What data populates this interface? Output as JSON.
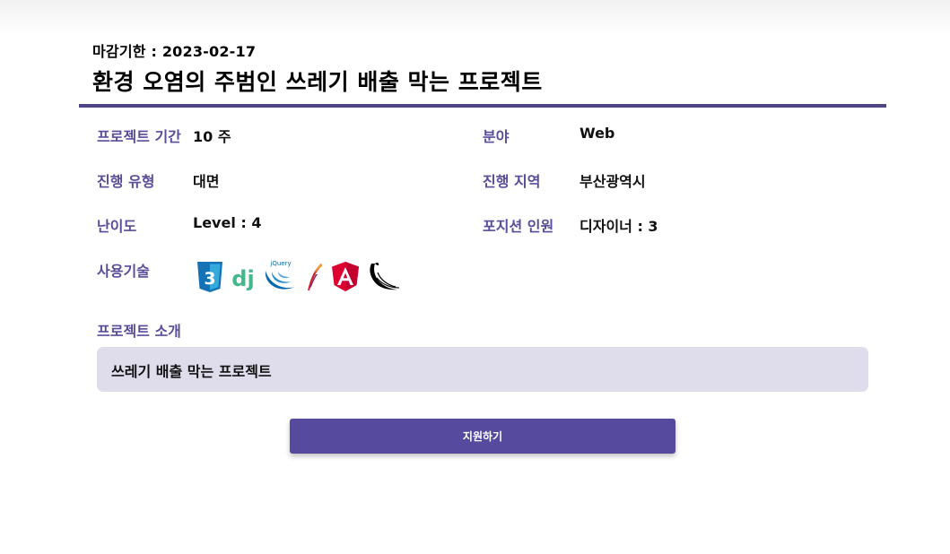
{
  "header": {
    "deadline": "마감기한 : 2023-02-17",
    "title": "환경 오염의 주범인 쓰레기 배출 막는 프로젝트"
  },
  "details": {
    "period_label": "프로젝트 기간",
    "period_value": "10 주",
    "field_label": "분야",
    "field_value": "Web",
    "type_label": "진행 유형",
    "type_value": "대면",
    "region_label": "진행 지역",
    "region_value": "부산광역시",
    "difficulty_label": "난이도",
    "difficulty_value": "Level : 4",
    "position_label": "포지션 인원",
    "position_value": "디자이너 : 3",
    "tech_label": "사용기술"
  },
  "tech_stack": {
    "icons": [
      "css3-icon",
      "django-icon",
      "jquery-icon",
      "apache-feather-icon",
      "angular-icon",
      "flask-icon"
    ],
    "jquery_text": "jQuery",
    "django_text": "dj",
    "css3_text": "3"
  },
  "intro": {
    "label": "프로젝트 소개",
    "text": "쓰레기 배출 막는 프로젝트"
  },
  "actions": {
    "apply_label": "지원하기"
  },
  "colors": {
    "accent": "#564a9f",
    "label": "#5a4c99",
    "intro_bg": "#dfdcec"
  }
}
